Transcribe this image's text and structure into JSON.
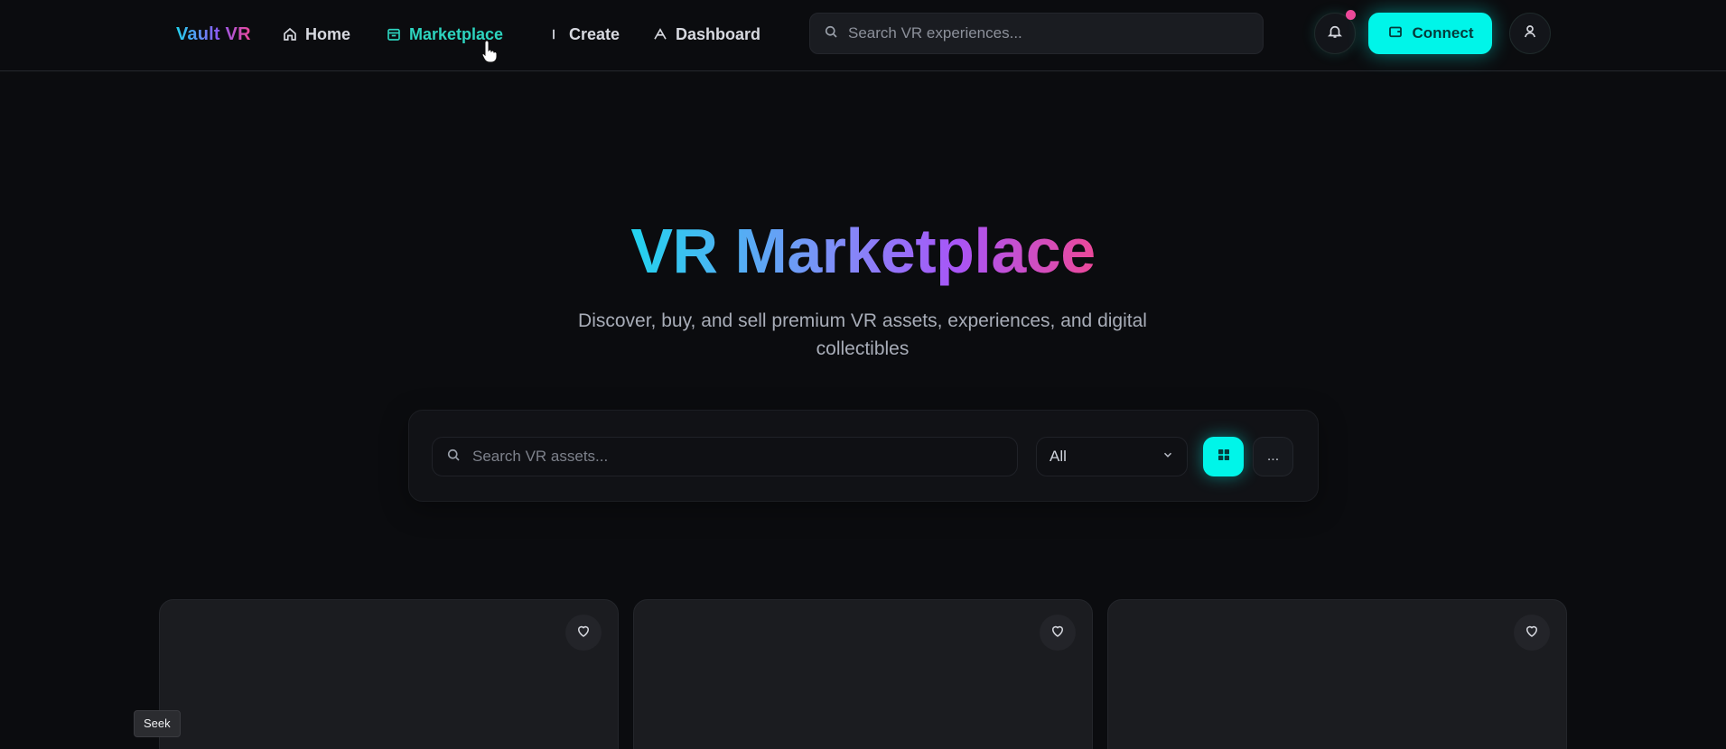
{
  "nav": {
    "brand": "Vault VR",
    "links": [
      {
        "label": "Home",
        "icon": "home-icon"
      },
      {
        "label": "Marketplace",
        "icon": "store-icon",
        "active": true
      },
      {
        "label": "Create",
        "icon": "create-icon"
      },
      {
        "label": "Dashboard",
        "icon": "dashboard-icon"
      }
    ],
    "search_placeholder": "Search VR experiences...",
    "connect_label": "Connect",
    "accent": "#00f5e9",
    "notification_dot_color": "#ec4899"
  },
  "hero": {
    "title": "VR Marketplace",
    "subtitle": "Discover, buy, and sell premium VR assets, experiences, and digital collectibles"
  },
  "filters": {
    "search_placeholder": "Search VR assets...",
    "category_value": "All",
    "list_view_label": "..."
  },
  "cards": [
    {
      "favorite_icon": "heart-icon"
    },
    {
      "favorite_icon": "heart-icon"
    },
    {
      "favorite_icon": "heart-icon"
    }
  ],
  "tooltip": {
    "seek": "Seek"
  }
}
